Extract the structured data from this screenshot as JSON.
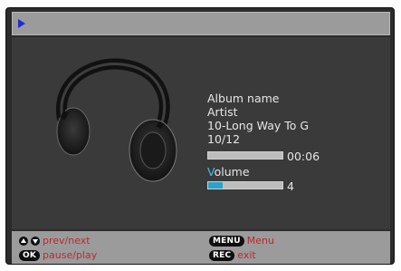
{
  "track": {
    "album": "Album name",
    "artist": "Artist",
    "title": "10-Long Way To G",
    "position": "10/12",
    "elapsed": "00:06",
    "progress_fraction": 0.0
  },
  "volume": {
    "label_first": "V",
    "label_rest": "olume",
    "value": "4",
    "level_fraction": 0.2
  },
  "hints": {
    "prev_next": "prev/next",
    "ok_key": "OK",
    "pause_play": "pause/play",
    "menu_key": "MENU",
    "menu": "Menu",
    "rec_key": "REC",
    "exit": "exit"
  },
  "colors": {
    "accent": "#2aa3c9",
    "hint_text": "#c1272d",
    "play_indicator": "#1b2bd6"
  },
  "icons": {
    "play": "play-indicator-icon",
    "art": "headphones-icon",
    "up": "arrow-up-button-icon",
    "down": "arrow-down-button-icon"
  }
}
